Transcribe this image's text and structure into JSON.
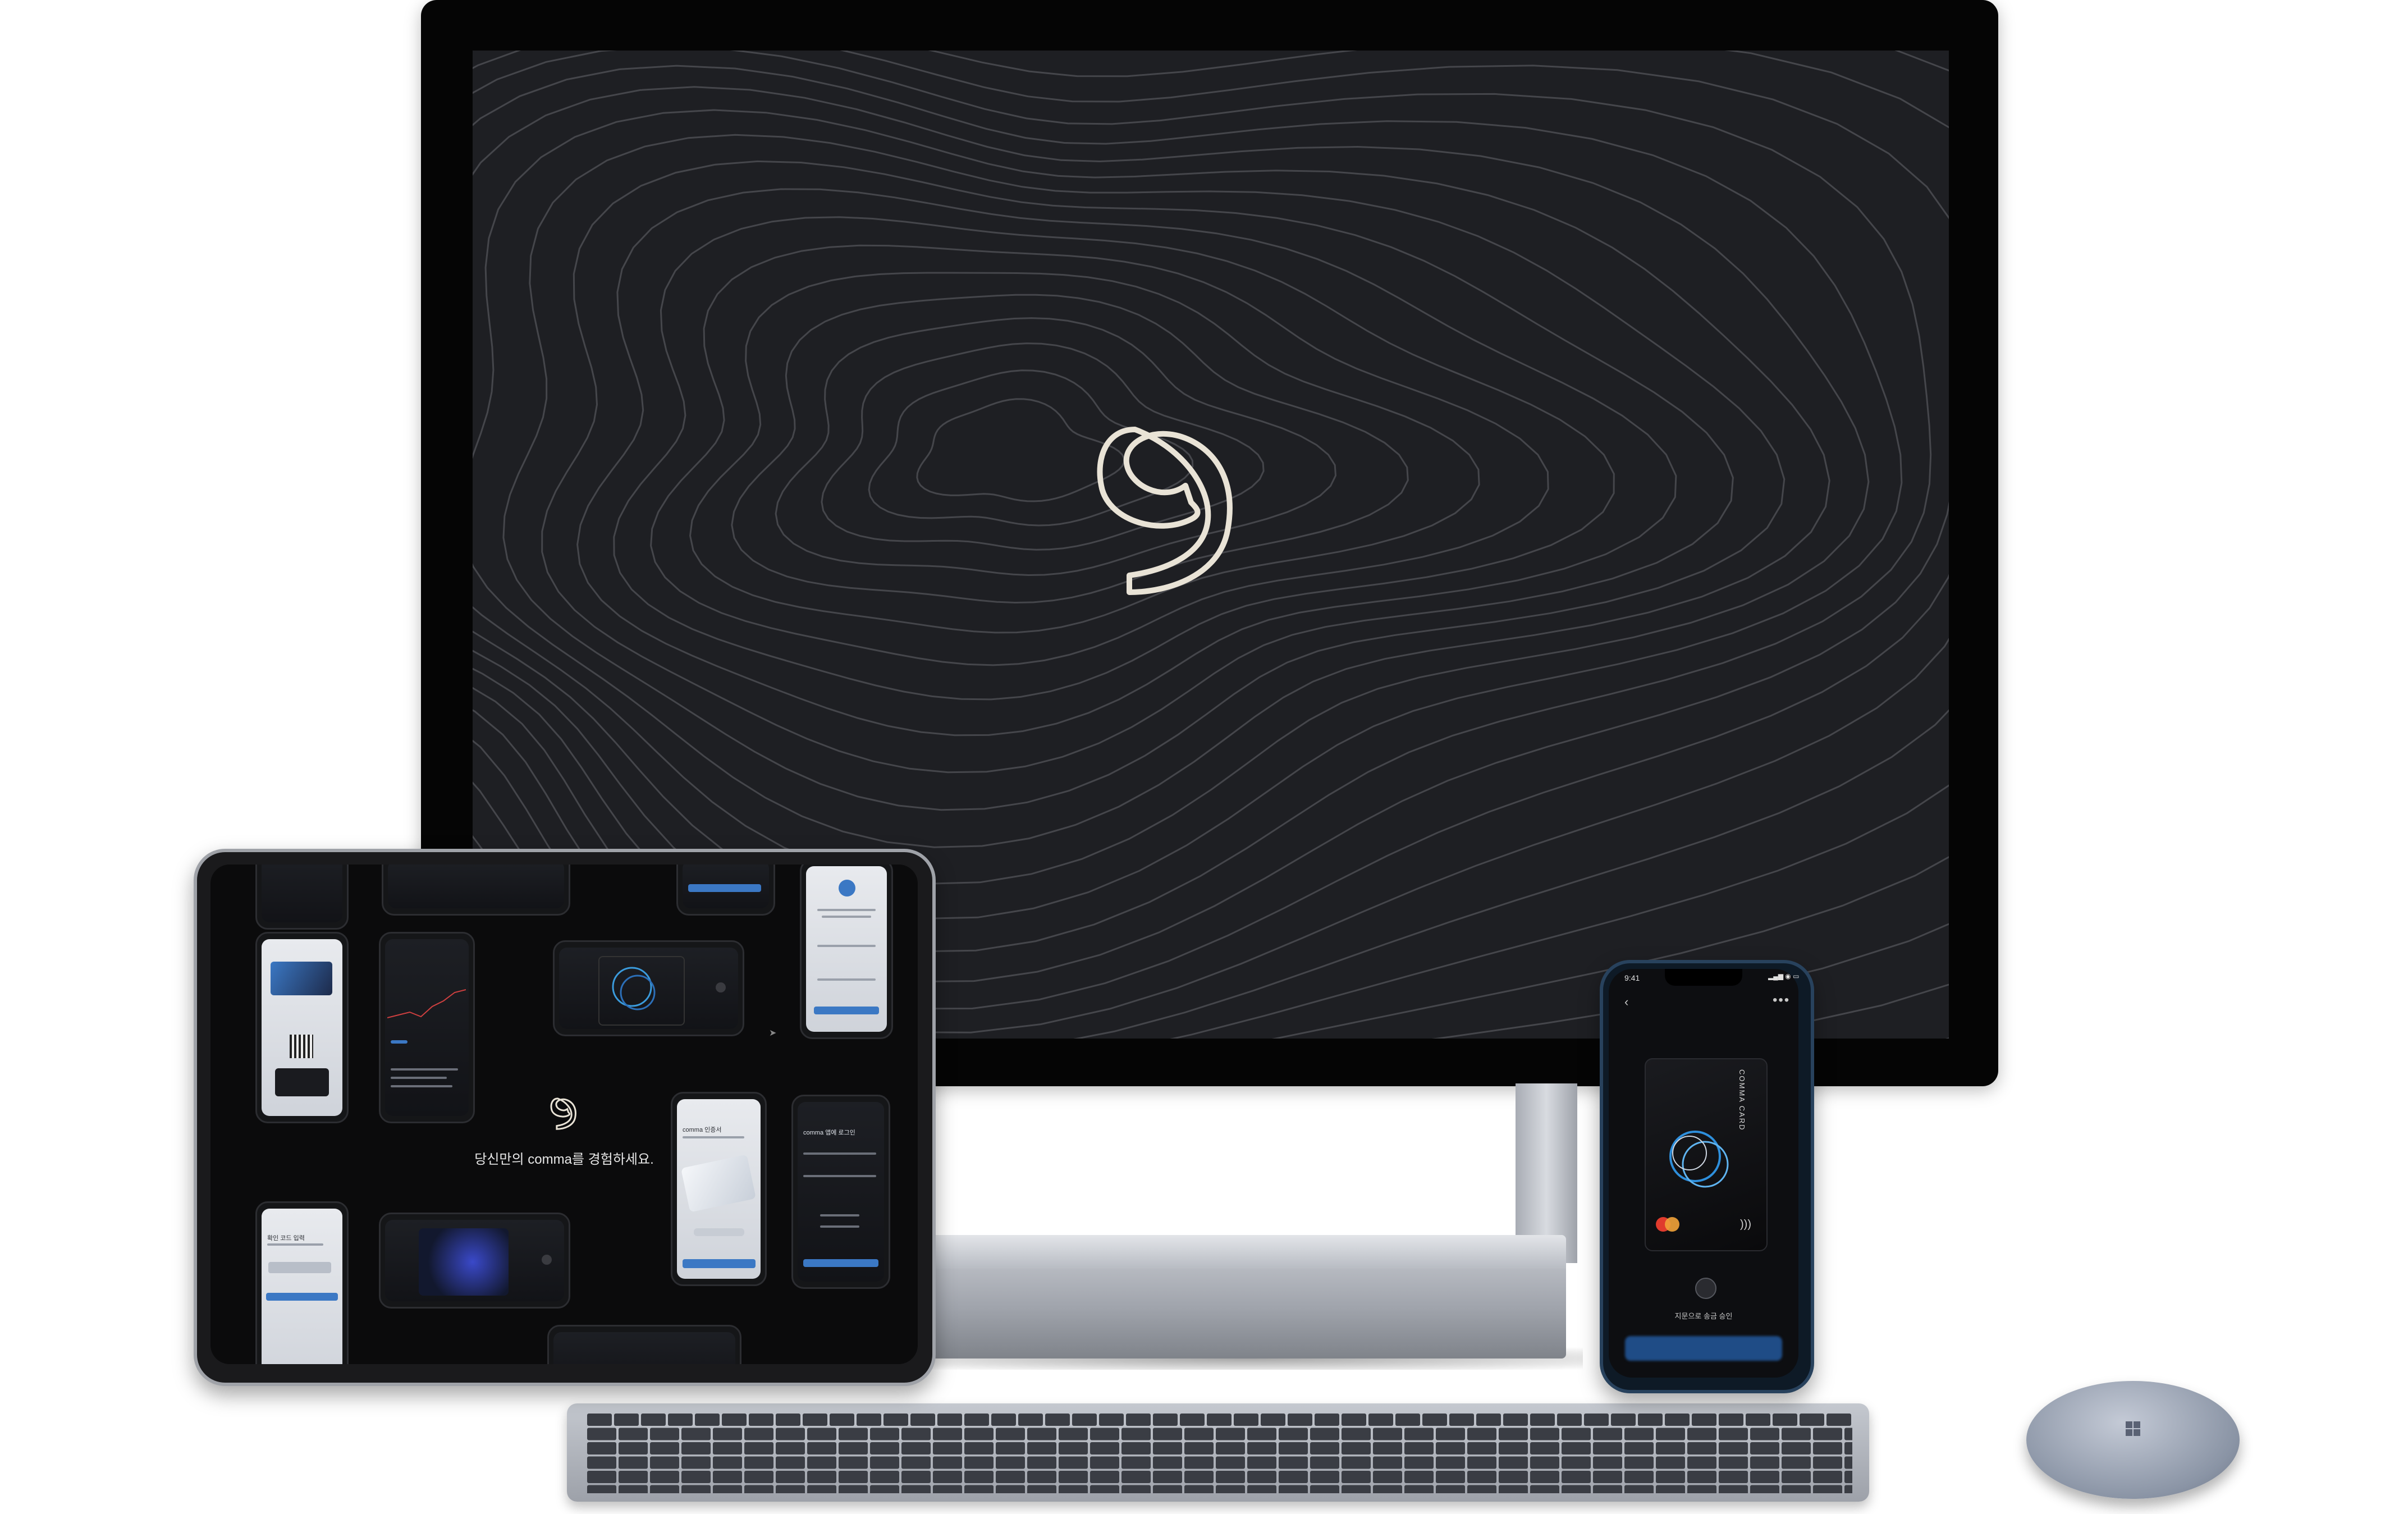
{
  "tablet": {
    "tagline": "당신만의 comma를 경험하세요.",
    "screens": [
      {
        "title": "comma 인증서"
      },
      {
        "title": "comma 앱에 로그인"
      },
      {
        "title": "확인 코드 입력"
      }
    ]
  },
  "phone": {
    "time": "9:41",
    "status": "▂▄▆ ◉ ▭",
    "back_icon": "‹",
    "more_icon": "•••",
    "card_text": "COMMA CARD",
    "nfc_icon": ")))",
    "instruction": "지문으로 송금 승인"
  },
  "colors": {
    "screen_bg": "#1e1f23",
    "contour_line": "#4a4b50",
    "logo_stroke": "#e9e3d6",
    "accent_blue": "#3b78c4"
  }
}
